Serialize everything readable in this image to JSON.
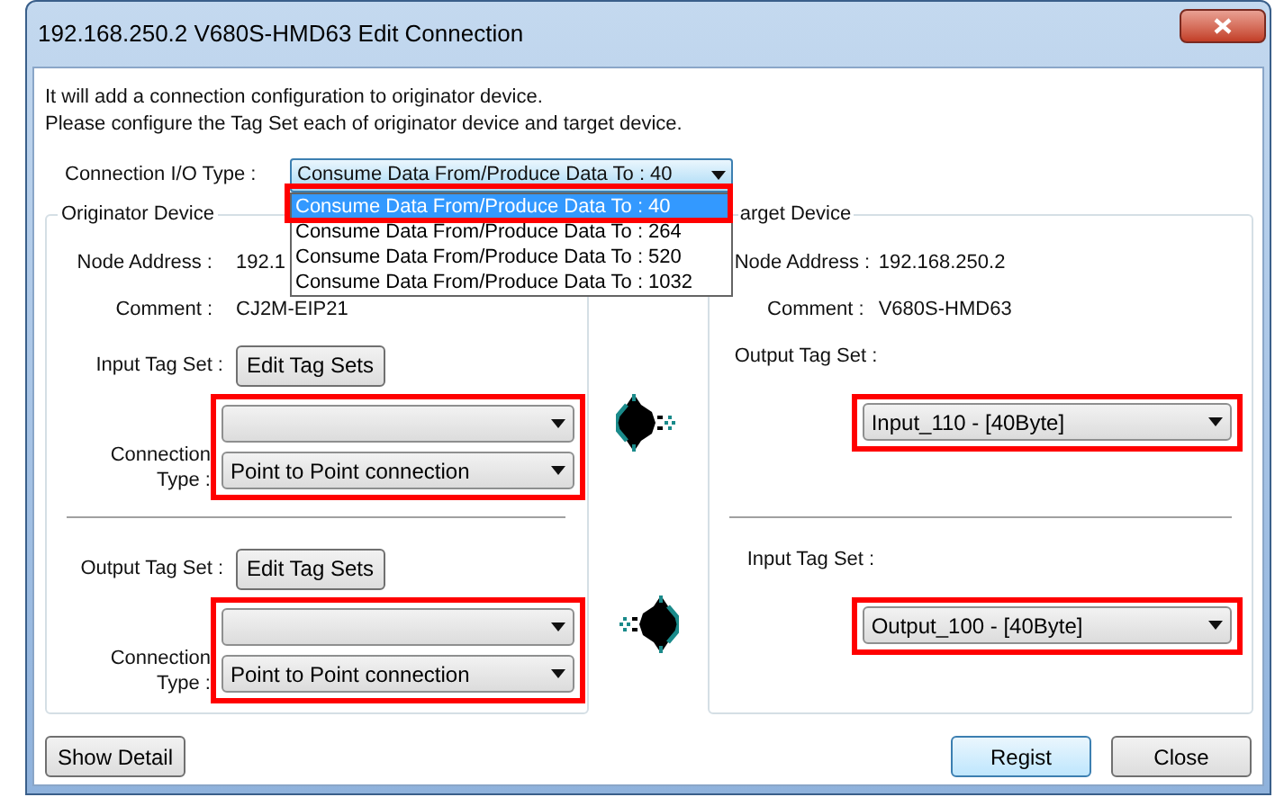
{
  "window": {
    "title": "192.168.250.2 V680S-HMD63 Edit Connection"
  },
  "intro": [
    "It will add a connection configuration to originator device.",
    "Please configure the Tag Set each of originator device and target device."
  ],
  "io_type": {
    "label": "Connection I/O Type :",
    "value": "Consume Data From/Produce Data To : 40",
    "expanded": true,
    "options": [
      {
        "label": "Consume Data From/Produce Data To : 40",
        "selected": true,
        "highlighted": true
      },
      {
        "label": "Consume Data From/Produce Data To : 264",
        "selected": false,
        "highlighted": false
      },
      {
        "label": "Consume Data From/Produce Data To : 520",
        "selected": false,
        "highlighted": false
      },
      {
        "label": "Consume Data From/Produce Data To : 1032",
        "selected": false,
        "highlighted": false
      }
    ]
  },
  "originator": {
    "title": "Originator Device",
    "fields": [
      {
        "label": "Node Address :",
        "value": "192.1"
      },
      {
        "label": "Comment :",
        "value": "CJ2M-EIP21"
      }
    ],
    "tag_sets": [
      {
        "label": "Input Tag Set :",
        "button": "Edit Tag Sets",
        "highlighted": true,
        "connection_type_label": "Connection Type :",
        "connection_type": "Point to Point connection"
      },
      {
        "label": "Output Tag Set :",
        "button": "Edit Tag Sets",
        "highlighted": true,
        "connection_type_label": "Connection Type :",
        "connection_type": "Point to Point connection"
      }
    ]
  },
  "target": {
    "title": "arget Device",
    "fields": [
      {
        "label": "Node Address :",
        "value": "192.168.250.2"
      },
      {
        "label": "Comment :",
        "value": "V680S-HMD63"
      }
    ],
    "tag_sets": [
      {
        "label": "Output Tag Set :",
        "value": "Input_110 - [40Byte]",
        "highlighted": true
      },
      {
        "label": "Input Tag Set :",
        "value": "Output_100 - [40Byte]",
        "highlighted": true
      }
    ]
  },
  "buttons": {
    "left": [
      {
        "label": "Show Detail",
        "default": false
      }
    ],
    "right": [
      {
        "label": "Regist",
        "default": true
      },
      {
        "label": "Close",
        "default": false
      }
    ]
  }
}
